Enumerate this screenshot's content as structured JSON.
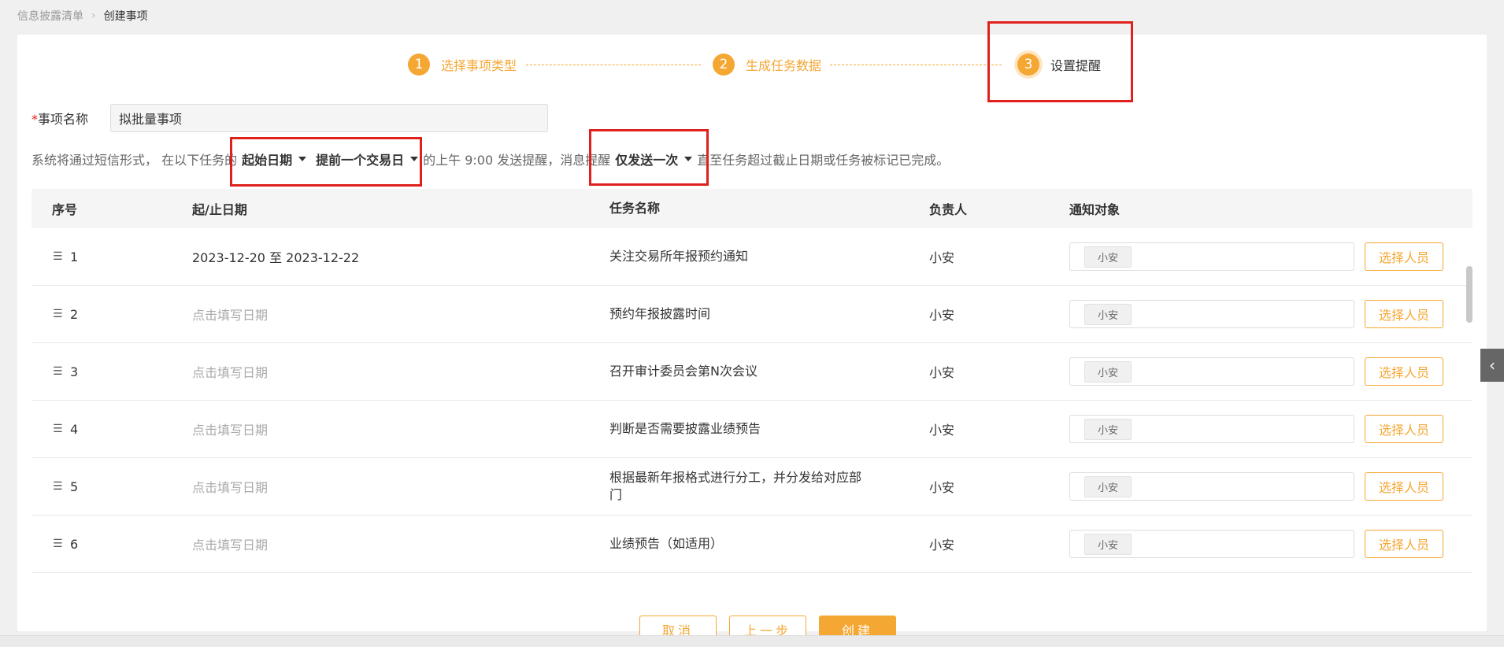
{
  "breadcrumb": {
    "parent": "信息披露清单",
    "current": "创建事项"
  },
  "steps": [
    {
      "num": "1",
      "label": "选择事项类型"
    },
    {
      "num": "2",
      "label": "生成任务数据"
    },
    {
      "num": "3",
      "label": "设置提醒"
    }
  ],
  "form": {
    "name_label": "事项名称",
    "required_mark": "*",
    "name_value": "拟批量事项"
  },
  "sentence": {
    "part1": "系统将通过短信形式， 在以下任务的",
    "date_type": "起始日期",
    "offset": "提前一个交易日",
    "part2": "的上午 9:00 发送提醒，消息提醒",
    "frequency": "仅发送一次",
    "part3": "直至任务超过截止日期或任务被标记已完成。"
  },
  "table": {
    "headers": {
      "index": "序号",
      "date": "起/止日期",
      "task": "任务名称",
      "owner": "负责人",
      "notify": "通知对象"
    },
    "rows": [
      {
        "index": "1",
        "date": "2023-12-20 至 2023-12-22",
        "date_empty": false,
        "task": "关注交易所年报预约通知",
        "owner": "小安",
        "tag": "小安",
        "btn": "选择人员"
      },
      {
        "index": "2",
        "date": "点击填写日期",
        "date_empty": true,
        "task": "预约年报披露时间",
        "owner": "小安",
        "tag": "小安",
        "btn": "选择人员"
      },
      {
        "index": "3",
        "date": "点击填写日期",
        "date_empty": true,
        "task": "召开审计委员会第N次会议",
        "owner": "小安",
        "tag": "小安",
        "btn": "选择人员"
      },
      {
        "index": "4",
        "date": "点击填写日期",
        "date_empty": true,
        "task": "判断是否需要披露业绩预告",
        "owner": "小安",
        "tag": "小安",
        "btn": "选择人员"
      },
      {
        "index": "5",
        "date": "点击填写日期",
        "date_empty": true,
        "task": "根据最新年报格式进行分工，并分发给对应部门",
        "owner": "小安",
        "tag": "小安",
        "btn": "选择人员"
      },
      {
        "index": "6",
        "date": "点击填写日期",
        "date_empty": true,
        "task": "业绩预告（如适用）",
        "owner": "小安",
        "tag": "小安",
        "btn": "选择人员"
      }
    ]
  },
  "footer": {
    "cancel": "取消",
    "prev": "上一步",
    "create": "创建"
  },
  "colors": {
    "accent": "#f5a733",
    "highlight": "#e0201c"
  },
  "icons": {
    "drag": "drag-list-icon",
    "collapse": "chevron-left-icon",
    "breadcrumb_sep": "chevron-right-icon"
  }
}
